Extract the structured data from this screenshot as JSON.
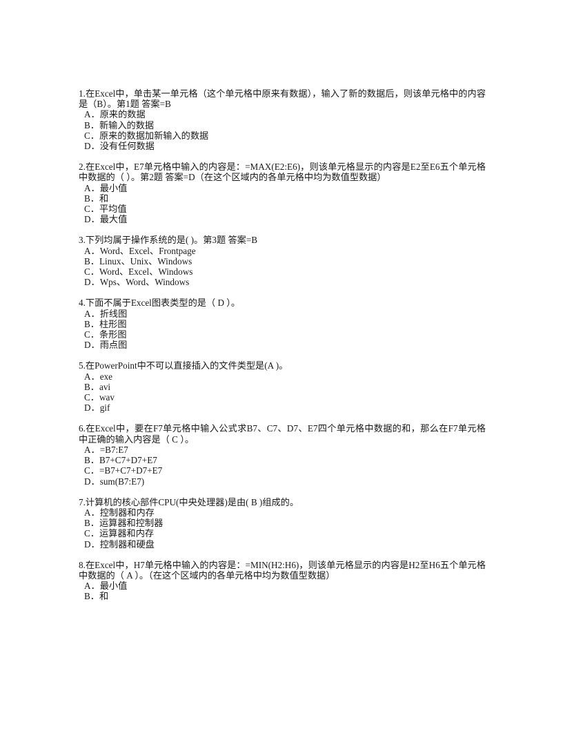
{
  "document": {
    "type": "exam-quiz-sheet",
    "language": "zh-CN",
    "text_color": "#1a1a1a",
    "background_color": "#ffffff"
  },
  "questions": [
    {
      "stem": "1.在Excel中，单击某一单元格（这个单元格中原来有数据），输入了新的数据后，则该单元格中的内容是（B）。第1题 答案=B",
      "options": [
        "A．原来的数据",
        "B．新输入的数据",
        "C．原来的数据加新输入的数据",
        "D．没有任何数据"
      ]
    },
    {
      "stem": "2.在Excel中，E7单元格中输入的内容是：=MAX(E2:E6)，则该单元格显示的内容是E2至E6五个单元格中数据的（    ）。第2题  答案=D（在这个区域内的各单元格中均为数值型数据）",
      "options": [
        "A．最小值",
        "B．和",
        "C．平均值",
        "D．最大值"
      ]
    },
    {
      "stem": "3.下列均属于操作系统的是(    )。第3题      答案=B",
      "options": [
        "A．Word、Excel、Frontpage",
        "B．Linux、Unix、Windows",
        "C．Word、Excel、Windows",
        "D．Wps、Word、Windows"
      ]
    },
    {
      "stem": "4.下面不属于Excel图表类型的是（ D    ）。",
      "options": [
        "A．折线图",
        "B．柱形图",
        "C．条形图",
        "D．雨点图"
      ]
    },
    {
      "stem": "5.在PowerPoint中不可以直接插入的文件类型是(A    )。",
      "options": [
        "A．exe",
        "B．avi",
        "C．wav",
        "D．gif"
      ]
    },
    {
      "stem": "6.在Excel中，要在F7单元格中输入公式求B7、C7、D7、E7四个单元格中数据的和，那么在F7单元格中正确的输入内容是（ C  ）。",
      "options": [
        "A．=B7:E7",
        "B．B7+C7+D7+E7",
        "C．=B7+C7+D7+E7",
        "D．sum(B7:E7)"
      ]
    },
    {
      "stem": "7.计算机的核心部件CPU(中央处理器)是由(  B  )组成的。",
      "options": [
        "A．控制器和内存",
        "B．运算器和控制器",
        "C．运算器和内存",
        "D．控制器和硬盘"
      ]
    },
    {
      "stem": "8.在Excel中，H7单元格中输入的内容是：=MIN(H2:H6)，则该单元格显示的内容是H2至H6五个单元格中数据的（ A  ）。（在这个区域内的各单元格中均为数值型数据）",
      "options": [
        "A．最小值",
        "B．和"
      ]
    }
  ]
}
